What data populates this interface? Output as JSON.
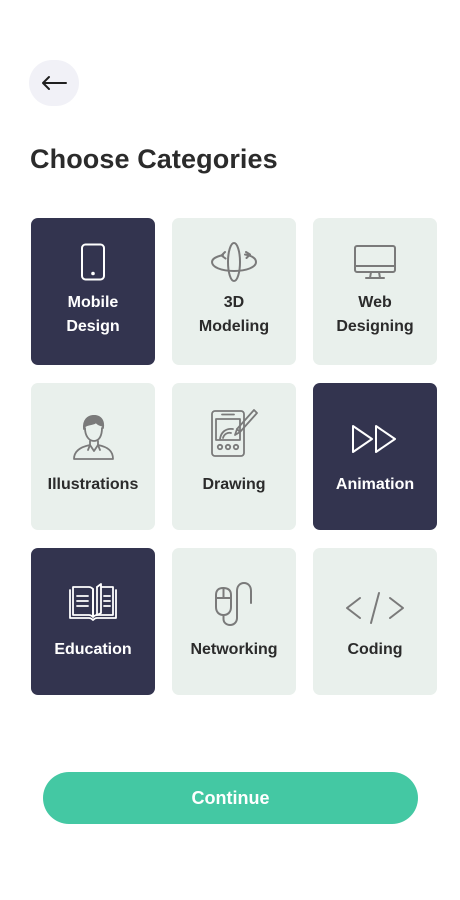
{
  "header": {
    "back_icon": "arrow-left-icon"
  },
  "page": {
    "title": "Choose Categories"
  },
  "categories": [
    {
      "id": "mobile-design",
      "label_line1": "Mobile",
      "label_line2": "Design",
      "icon": "mobile-phone-icon",
      "selected": true
    },
    {
      "id": "3d-modeling",
      "label_line1": "3D",
      "label_line2": "Modeling",
      "icon": "3d-rotate-icon",
      "selected": false
    },
    {
      "id": "web-designing",
      "label_line1": "Web",
      "label_line2": "Designing",
      "icon": "monitor-icon",
      "selected": false
    },
    {
      "id": "illustrations",
      "label_line1": "Illustrations",
      "label_line2": "",
      "icon": "person-illustration-icon",
      "selected": false
    },
    {
      "id": "drawing",
      "label_line1": "Drawing",
      "label_line2": "",
      "icon": "tablet-drawing-icon",
      "selected": false
    },
    {
      "id": "animation",
      "label_line1": "Animation",
      "label_line2": "",
      "icon": "fast-forward-icon",
      "selected": true
    },
    {
      "id": "education",
      "label_line1": "Education",
      "label_line2": "",
      "icon": "open-book-icon",
      "selected": true
    },
    {
      "id": "networking",
      "label_line1": "Networking",
      "label_line2": "",
      "icon": "mouse-cable-icon",
      "selected": false
    },
    {
      "id": "coding",
      "label_line1": "Coding",
      "label_line2": "",
      "icon": "code-brackets-icon",
      "selected": false
    }
  ],
  "footer": {
    "continue_label": "Continue"
  },
  "colors": {
    "selected_card": "#33344f",
    "unselected_card": "#e9f0ec",
    "accent": "#44c8a3",
    "title_text": "#2b2b2b",
    "back_button_bg": "#f1f1f7"
  }
}
